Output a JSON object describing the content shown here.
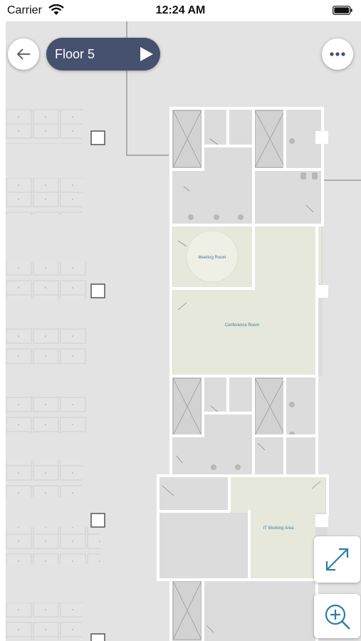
{
  "status_bar": {
    "carrier": "Carrier",
    "time": "12:24 AM",
    "wifi_icon": "wifi-icon",
    "battery_icon": "battery-icon"
  },
  "toolbar": {
    "back_icon": "arrow-left-icon",
    "floor_label": "Floor 5",
    "play_icon": "play-icon",
    "more_icon": "ellipsis-icon"
  },
  "map": {
    "rooms": {
      "meeting_room": "Meeting Room",
      "conference_room": "Conference Room",
      "it_working_area": "IT Working Area"
    }
  },
  "controls": {
    "expand_icon": "expand-arrows-icon",
    "zoom_icon": "zoom-in-icon"
  },
  "colors": {
    "accent": "#2a7fa8",
    "pill": "#46506f",
    "room_fill": "#e6e8dc",
    "map_bg": "#e3e3e3"
  }
}
